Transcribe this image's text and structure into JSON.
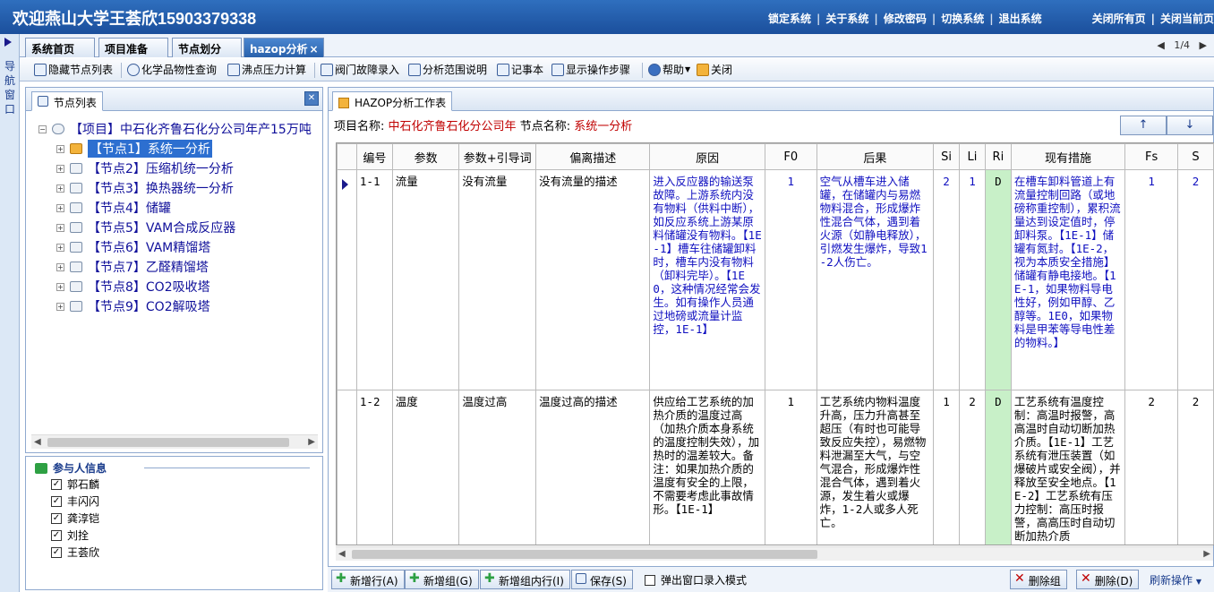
{
  "header": {
    "title": "欢迎燕山大学王荟欣15903379338",
    "links": [
      "锁定系统",
      "关于系统",
      "修改密码",
      "切换系统",
      "退出系统"
    ],
    "right_links": [
      "关闭所有页",
      "关闭当前页"
    ]
  },
  "nav": {
    "label": "导航窗口"
  },
  "tabs": [
    {
      "label": "系统首页"
    },
    {
      "label": "项目准备"
    },
    {
      "label": "节点划分"
    },
    {
      "label": "hazop分析",
      "close": "×"
    }
  ],
  "pager": {
    "text": "1/4"
  },
  "toolbar": [
    {
      "label": "隐藏节点列表",
      "icon": "list-icon"
    },
    {
      "label": "化学品物性查询",
      "icon": "search-icon"
    },
    {
      "label": "沸点压力计算",
      "icon": "calc-icon"
    },
    {
      "label": "阀门故障录入",
      "icon": "valve-icon"
    },
    {
      "label": "分析范围说明",
      "icon": "doc-icon"
    },
    {
      "label": "记事本",
      "icon": "notepad-icon"
    },
    {
      "label": "显示操作步骤",
      "icon": "steps-icon"
    },
    {
      "label": "帮助",
      "icon": "help-icon"
    },
    {
      "label": "关闭",
      "icon": "close-icon"
    }
  ],
  "node_list": {
    "tab_label": "节点列表",
    "project": "【项目】中石化齐鲁石化分公司年产15万吨",
    "nodes": [
      "【节点1】系统一分析",
      "【节点2】压缩机统一分析",
      "【节点3】换热器统一分析",
      "【节点4】储罐",
      "【节点5】VAM合成反应器",
      "【节点6】VAM精馏塔",
      "【节点7】乙醛精馏塔",
      "【节点8】CO2吸收塔",
      "【节点9】CO2解吸塔"
    ]
  },
  "participants": {
    "title": "参与人信息",
    "names": [
      "郭石麟",
      "丰闪闪",
      "龚淳铠",
      "刘拴",
      "王荟欣"
    ]
  },
  "worksheet": {
    "tab_label": "HAZOP分析工作表",
    "project_label": "项目名称:",
    "project_name": "中石化齐鲁石化分公司年",
    "node_label": "节点名称:",
    "node_name": "系统一分析",
    "up_label": "↑",
    "down_label": "↓",
    "columns": [
      "编号",
      "参数",
      "参数+引导词",
      "偏离描述",
      "原因",
      "F0",
      "后果",
      "Si",
      "Li",
      "Ri",
      "现有措施",
      "Fs",
      "S"
    ],
    "rows": [
      {
        "no": "1-1",
        "param": "流量",
        "guide": "没有流量",
        "desc": "没有流量的描述",
        "cause": "进入反应器的输送泵故障。上游系统内没有物料（供料中断），如反应系统上游某原料储罐没有物料。【1E-1】槽车往储罐卸料时，槽车内没有物料（卸料完毕）。【1E0，这种情况经常会发生。如有操作人员通过地磅或流量计监控，1E-1】",
        "f0": "1",
        "consequence": "空气从槽车进入储罐，在储罐内与易燃物料混合，形成爆炸性混合气体，遇到着火源（如静电释放），引燃发生爆炸，导致1-2人伤亡。",
        "si": "2",
        "li": "1",
        "ri": "D",
        "measures": "在槽车卸料管道上有流量控制回路（或地磅称重控制），累积流量达到设定值时，停卸料泵。【1E-1】储罐有氮封。【1E-2，视为本质安全措施】储罐有静电接地。【1E-1，如果物料导电性好，例如甲醇、乙醇等。1E0，如果物料是甲苯等导电性差的物料。】",
        "fs": "1",
        "s": "2"
      },
      {
        "no": "1-2",
        "param": "温度",
        "guide": "温度过高",
        "desc": "温度过高的描述",
        "cause": "供应给工艺系统的加热介质的温度过高（加热介质本身系统的温度控制失效），加热时的温差较大。备注：如果加热介质的温度有安全的上限，不需要考虑此事故情形。【1E-1】",
        "f0": "1",
        "consequence": "工艺系统内物料温度升高，压力升高甚至超压（有时也可能导致反应失控），易燃物料泄漏至大气，与空气混合，形成爆炸性混合气体，遇到着火源，发生着火或爆炸，1-2人或多人死亡。",
        "si": "1",
        "li": "2",
        "ri": "D",
        "measures": "工艺系统有温度控制：高温时报警，高高温时自动切断加热介质。【1E-1】工艺系统有泄压装置（如爆破片或安全阀），并释放至安全地点。【1E-2】工艺系统有压力控制：高压时报警，高高压时自动切断加热介质",
        "fs": "2",
        "s": "2"
      }
    ]
  },
  "bottom_buttons": [
    {
      "label": "新增行(A)",
      "icon": "plus-icon"
    },
    {
      "label": "新增组(G)",
      "icon": "plus-icon"
    },
    {
      "label": "新增组内行(I)",
      "icon": "plus-icon"
    },
    {
      "label": "保存(S)",
      "icon": "save-icon"
    }
  ],
  "popup_mode": {
    "label": "弹出窗口录入模式",
    "checked": false
  },
  "delete_buttons": [
    {
      "label": "删除组",
      "icon": "delete-icon"
    },
    {
      "label": "删除(D)",
      "icon": "delete-icon"
    }
  ],
  "refresh": {
    "label": "刷新操作"
  }
}
